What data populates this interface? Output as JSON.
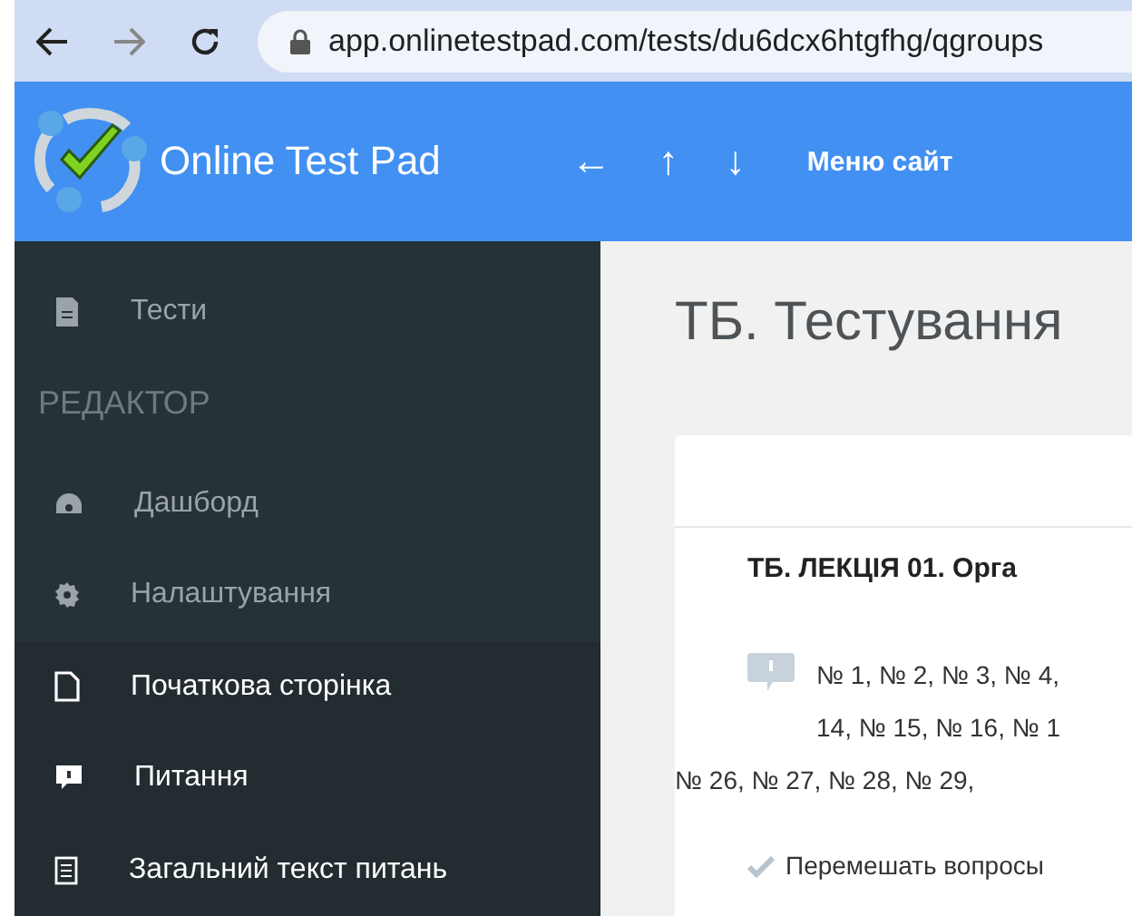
{
  "browser": {
    "url": "app.onlinetestpad.com/tests/du6dcx6htgfhg/qgroups"
  },
  "header": {
    "brand": "Online Test Pad",
    "nav_arrows": [
      "←",
      "↑",
      "↓"
    ],
    "menu": "Меню сайт"
  },
  "sidebar": {
    "items": [
      {
        "label": "Тести",
        "kind": "doc",
        "highlighted": false
      }
    ],
    "section": "РЕДАКТОР",
    "editor_items": [
      {
        "label": "Дашборд",
        "kind": "gauge",
        "highlighted": false
      },
      {
        "label": "Налаштування",
        "kind": "gear",
        "highlighted": false
      },
      {
        "label": "Початкова сторінка",
        "kind": "page",
        "highlighted": true
      },
      {
        "label": "Питання",
        "kind": "question",
        "highlighted": true
      },
      {
        "label": "Загальний текст питань",
        "kind": "list",
        "highlighted": true
      }
    ]
  },
  "content": {
    "title": "ТБ. Тестування",
    "group": {
      "title": "ТБ. ЛЕКЦІЯ 01. Орга",
      "question_lines": [
        "№ 1, № 2, № 3, № 4,",
        "14, № 15, № 16, № 1",
        "№ 26, № 27, № 28, № 29,"
      ],
      "option": {
        "label": "Перемешать вопросы",
        "checked": true
      }
    }
  }
}
